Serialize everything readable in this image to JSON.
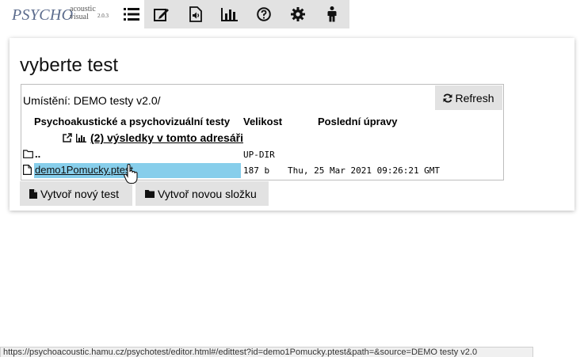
{
  "logo": {
    "main": "PSYCHO",
    "line1": "acoustic",
    "line2": "visual",
    "version": "2.0.3"
  },
  "toolbar": {
    "items": [
      {
        "icon": "list-icon"
      },
      {
        "icon": "edit-icon"
      },
      {
        "icon": "audio-file-icon"
      },
      {
        "icon": "chart-icon"
      },
      {
        "icon": "help-icon"
      },
      {
        "icon": "gear-icon"
      },
      {
        "icon": "person-icon"
      }
    ]
  },
  "page": {
    "title": "vyberte test"
  },
  "browser": {
    "location": "Umístění: DEMO testy v2.0/",
    "refresh_label": "Refresh",
    "columns": {
      "name": "Psychoakustické a psychovizuální testy",
      "size": "Velikost",
      "modified": "Poslední úpravy"
    },
    "results_link": "(2) výsledky v tomto adresáři",
    "rows": [
      {
        "name": "..",
        "size": "UP-DIR",
        "modified": "",
        "icon": "folder-icon"
      },
      {
        "name": "demo1Pomucky.ptest",
        "size": "187 b",
        "modified": "Thu, 25 Mar 2021 09:26:21 GMT",
        "icon": "file-icon"
      }
    ]
  },
  "actions": {
    "new_test": "Vytvoř nový test",
    "new_folder": "Vytvoř novou složku"
  },
  "status_url": "https://psychoacoustic.hamu.cz/psychotest/editor.html#/edittest?id=demo1Pomucky.ptest&path=&source=DEMO testy v2.0",
  "colors": {
    "selection": "#87ceeb",
    "button": "#e2e2e2",
    "logo": "#5b6b8c"
  }
}
